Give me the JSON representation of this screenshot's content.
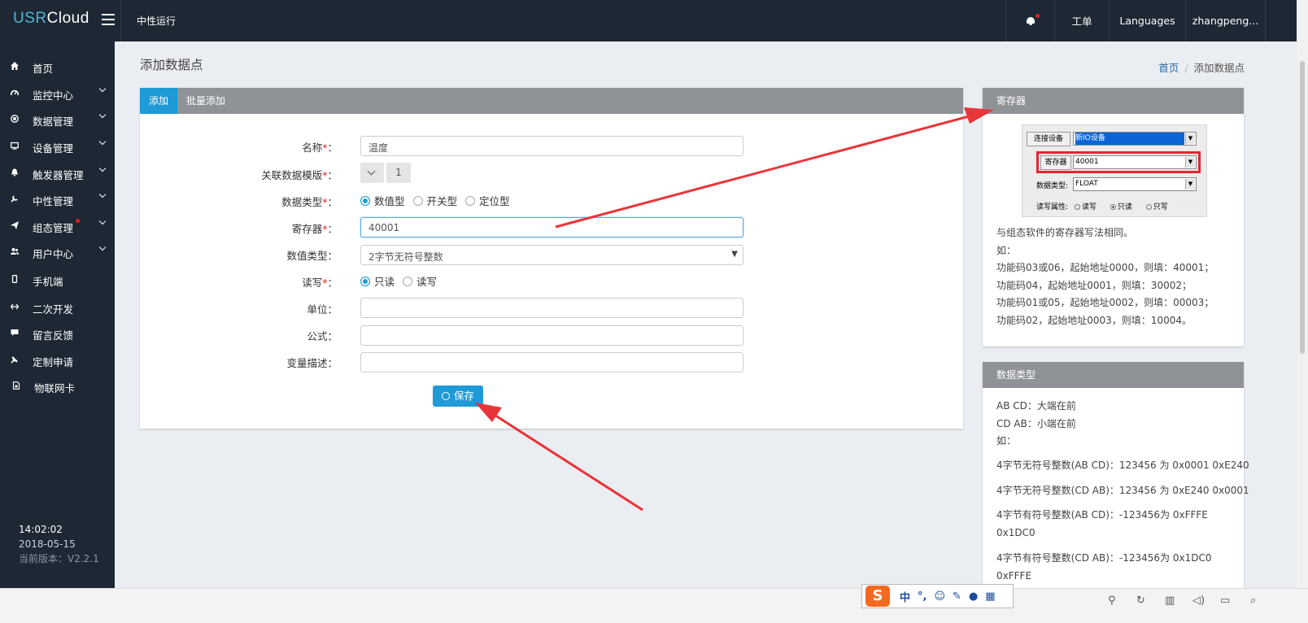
{
  "app": {
    "logo_usr": "USR",
    "logo_cloud": "Cloud",
    "top_title": "中性运行",
    "top_right": {
      "ticket": "工单",
      "languages": "Languages",
      "user": "zhangpeng..."
    }
  },
  "sidebar": {
    "items": [
      {
        "label": "首页",
        "icon": "home-icon",
        "has_children": false
      },
      {
        "label": "监控中心",
        "icon": "gauge-icon",
        "has_children": true
      },
      {
        "label": "数据管理",
        "icon": "circle-dot-icon",
        "has_children": true
      },
      {
        "label": "设备管理",
        "icon": "monitor-icon",
        "has_children": true
      },
      {
        "label": "触发器管理",
        "icon": "bell-icon",
        "has_children": true
      },
      {
        "label": "中性管理",
        "icon": "wrench-icon",
        "has_children": true
      },
      {
        "label": "组态管理",
        "icon": "send-icon",
        "has_children": true,
        "badge": true
      },
      {
        "label": "用户中心",
        "icon": "users-icon",
        "has_children": true
      },
      {
        "label": "手机端",
        "icon": "mobile-icon",
        "has_children": false
      },
      {
        "label": "二次开发",
        "icon": "code-arrows-icon",
        "has_children": false
      },
      {
        "label": "留言反馈",
        "icon": "comment-icon",
        "has_children": false
      },
      {
        "label": "定制申请",
        "icon": "tools-icon",
        "has_children": false
      },
      {
        "label": "物联网卡",
        "icon": "sim-card-icon",
        "has_children": false
      }
    ],
    "footer": {
      "time": "14:02:02",
      "date": "2018-05-15",
      "version": "当前版本：V2.2.1"
    }
  },
  "page": {
    "title": "添加数据点",
    "breadcrumb": {
      "home": "首页",
      "sep": "/",
      "current": "添加数据点"
    }
  },
  "form": {
    "tabs": [
      "添加",
      "批量添加"
    ],
    "req": "*",
    "colon": "：",
    "name_label": "名称",
    "name_value": "温度",
    "template_label": "关联数据模版",
    "template_value": "1",
    "data_type_label": "数据类型",
    "data_type_options": [
      "数值型",
      "开关型",
      "定位型"
    ],
    "data_type_selected": "数值型",
    "register_label": "寄存器",
    "register_value": "40001",
    "value_type_label": "数值类型",
    "value_type_value": "2字节无符号整数",
    "rw_label": "读写",
    "rw_options": [
      "只读",
      "读写"
    ],
    "rw_selected": "只读",
    "unit_label": "单位",
    "unit_value": "",
    "formula_label": "公式",
    "formula_value": "",
    "desc_label": "变量描述",
    "desc_value": "",
    "save_label": "保存"
  },
  "register_panel": {
    "title": "寄存器",
    "embed": {
      "connect_btn": "连接设备",
      "device_value": "新IO设备",
      "register_btn": "寄存器",
      "register_value": "40001",
      "data_type_label": "数据类型:",
      "data_type_value": "FLOAT",
      "rw_label": "读写属性:",
      "rw_options": [
        "读写",
        "只读",
        "只写"
      ],
      "rw_selected": "只读"
    },
    "lines": [
      "与组态软件的寄存器写法相同。",
      "如：",
      "功能码03或06，起始地址0000，则填：40001；",
      "功能码04，起始地址0001，则填：30002；",
      "功能码01或05，起始地址0002，则填：00003；",
      "功能码02，起始地址0003，则填：10004。"
    ]
  },
  "datatype_panel": {
    "title": "数据类型",
    "lines_a": [
      "AB CD：大端在前",
      "CD AB：小端在前",
      "如："
    ],
    "line_1": "4字节无符号整数(AB CD)：123456 为 0x0001 0xE240",
    "line_2": "4字节无符号整数(CD AB)：123456 为 0xE240 0x0001",
    "line_3a": "4字节有符号整数(AB CD)：-123456为 0xFFFE",
    "line_3b": "0x1DC0",
    "line_4a": "4字节有符号整数(CD AB)：-123456为 0x1DC0",
    "line_4b": "0xFFFE"
  },
  "taskbar": {
    "ime_logo": "S",
    "ime_lang": "中",
    "ime_punct": "°,"
  },
  "colors": {
    "accent": "#1e9ad6",
    "sidebar_bg": "#1d2834",
    "arrow": "#e8353a",
    "required": "#e02020"
  }
}
